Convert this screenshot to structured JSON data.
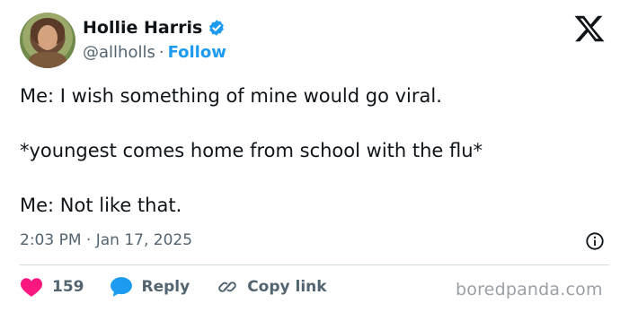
{
  "author": {
    "name": "Hollie Harris",
    "handle": "@allholls",
    "separator": "·",
    "follow_label": "Follow"
  },
  "tweet": {
    "lines": [
      "Me: I wish something of mine would go viral.",
      "*youngest comes home from school with the flu*",
      "Me: Not like that."
    ],
    "timestamp": "2:03 PM · Jan 17, 2025"
  },
  "actions": {
    "like_count": "159",
    "reply_label": "Reply",
    "copy_link_label": "Copy link"
  },
  "watermark": "boredpanda.com",
  "icons": {
    "verified": "verified-badge-icon",
    "platform": "x-logo-icon",
    "info": "info-icon",
    "like": "heart-icon",
    "reply": "speech-bubble-icon",
    "copy_link": "link-icon"
  },
  "colors": {
    "like": "#f91880",
    "reply": "#1d9bf0",
    "follow": "#1d9bf0",
    "verified": "#1d9bf0"
  }
}
